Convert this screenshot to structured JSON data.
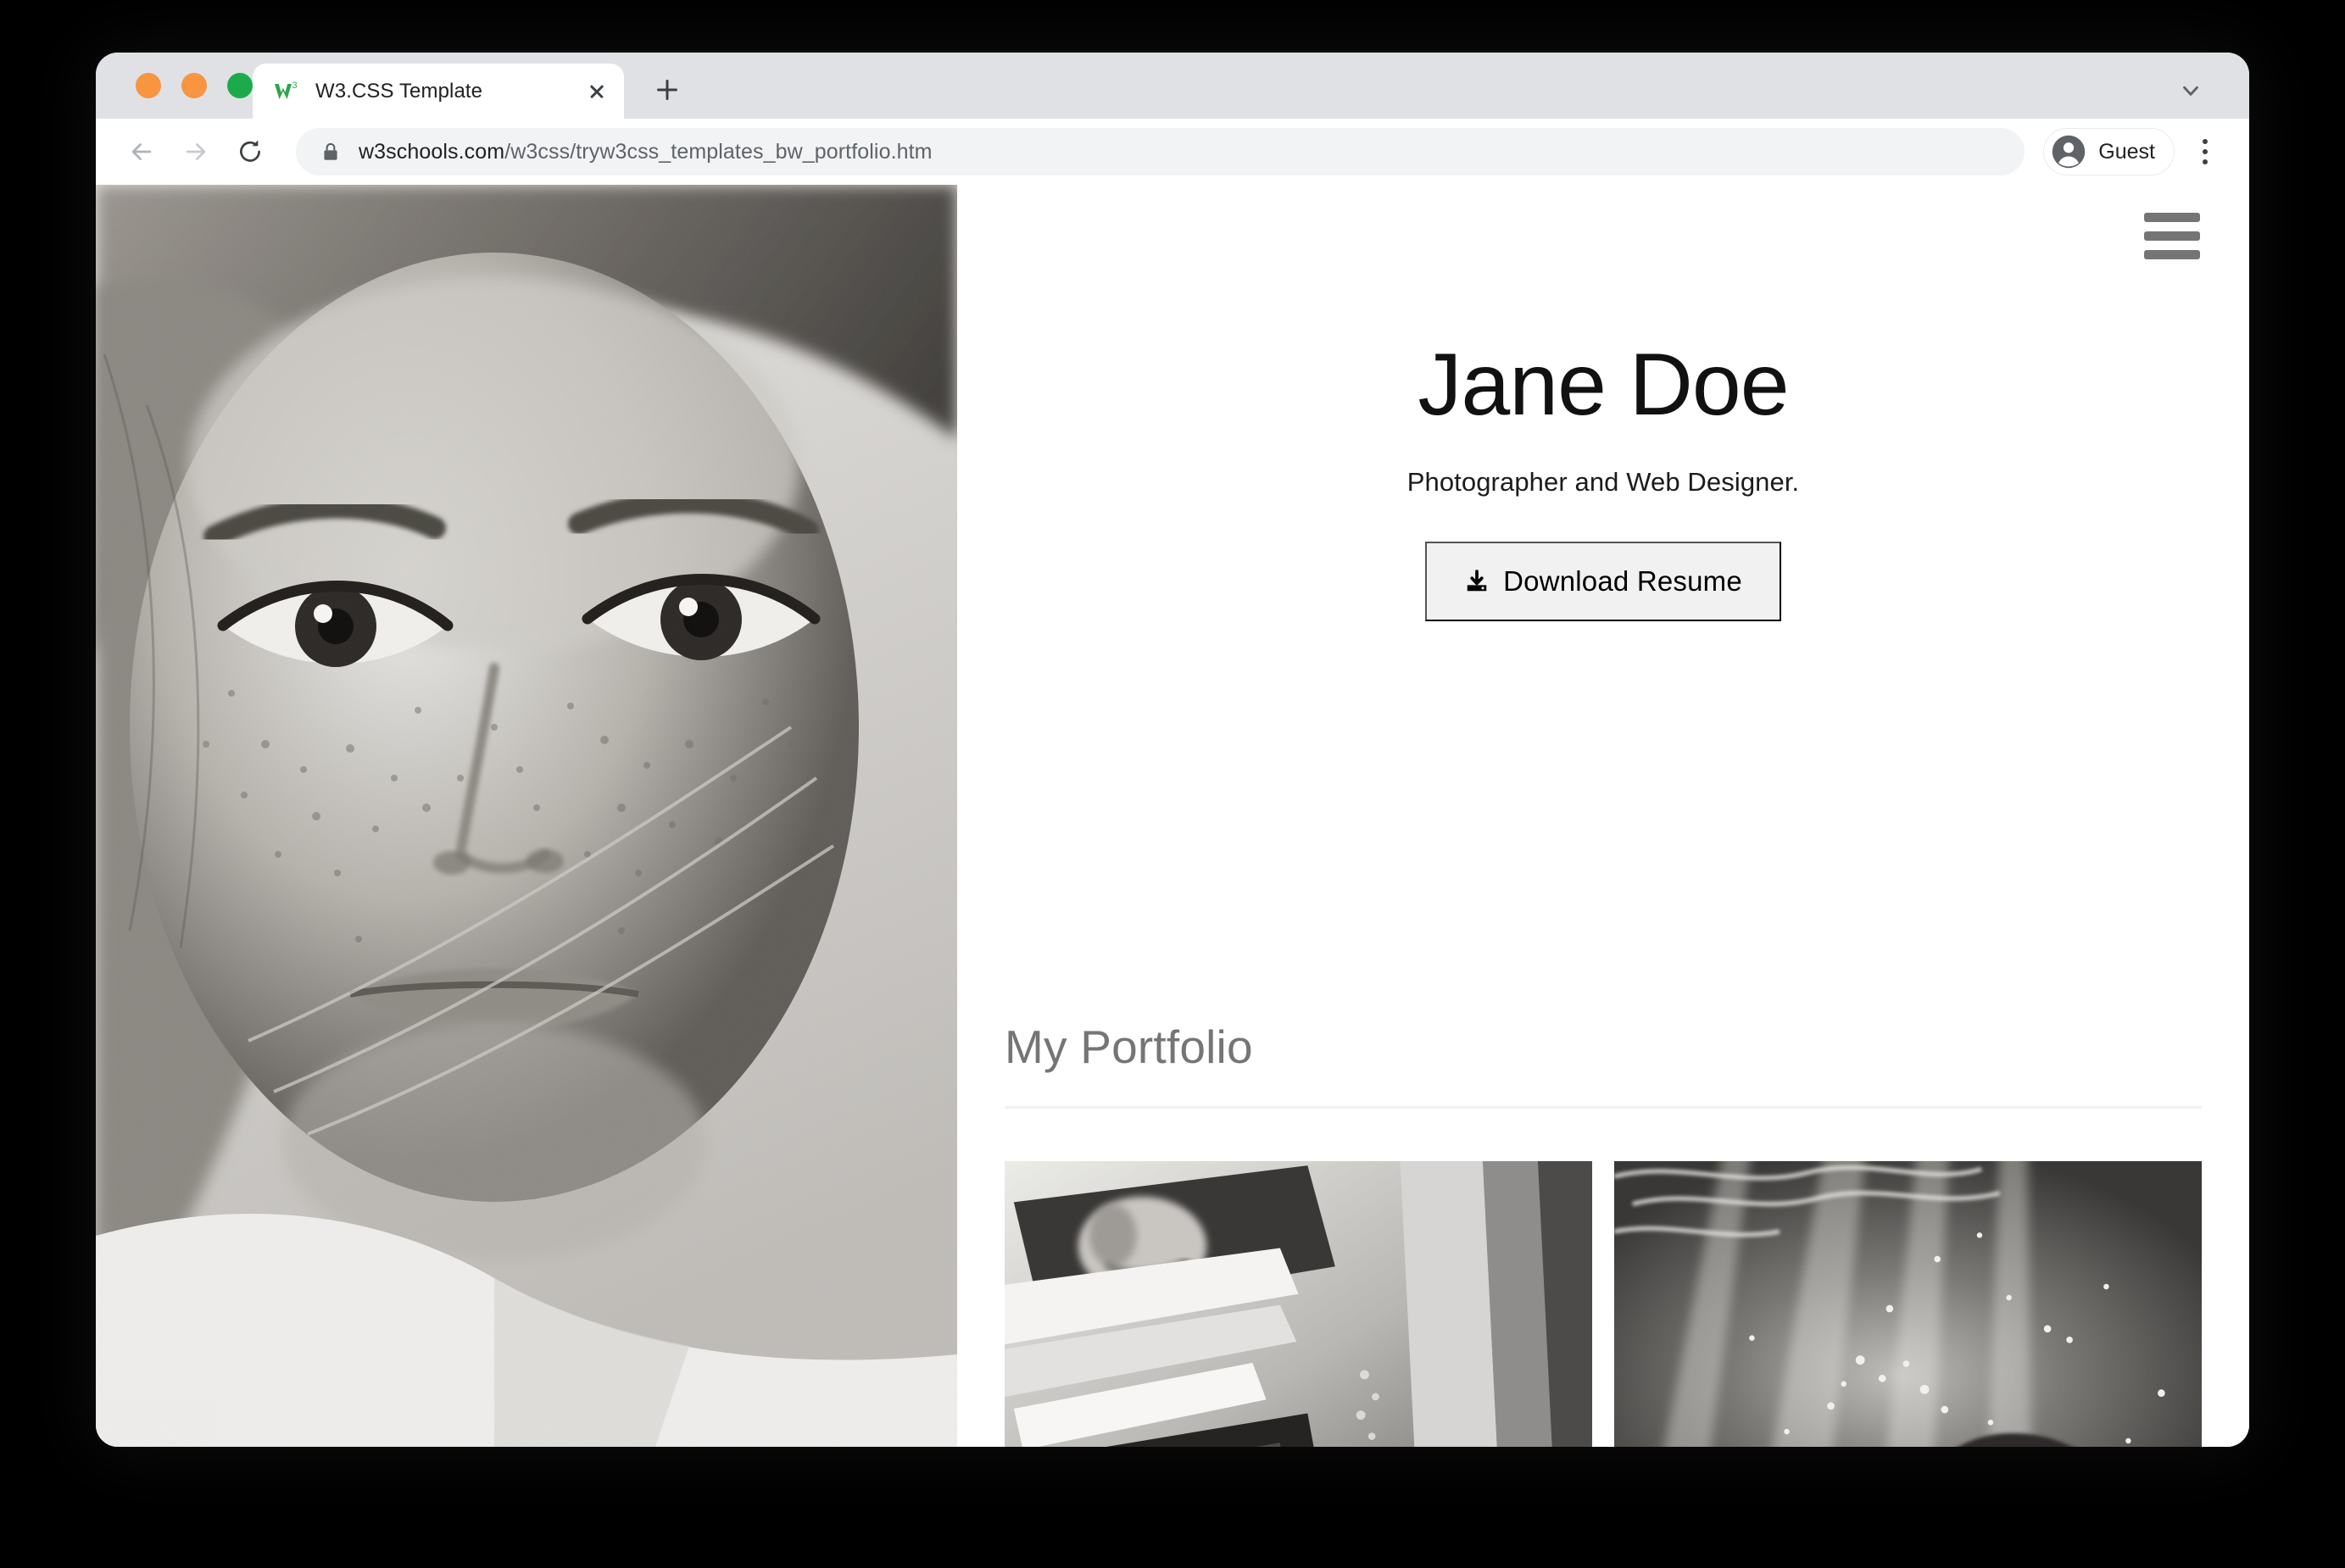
{
  "window": {
    "traffic_lights": [
      {
        "name": "close",
        "color": "#f79540"
      },
      {
        "name": "minimize",
        "color": "#f79540"
      },
      {
        "name": "maximize",
        "color": "#1cab4b"
      }
    ]
  },
  "browser": {
    "tab": {
      "title": "W3.CSS Template",
      "favicon_name": "w3schools-favicon",
      "favicon_color": "#2EA44F",
      "close_label": "×"
    },
    "new_tab_label": "+",
    "tab_search_icon": "chevron-down-icon",
    "toolbar": {
      "back_icon": "back-arrow-icon",
      "forward_icon": "forward-arrow-icon",
      "reload_icon": "reload-icon",
      "lock_icon": "lock-icon",
      "url_host": "w3schools.com",
      "url_path": "/w3css/tryw3css_templates_bw_portfolio.htm",
      "url_full": "w3schools.com/w3css/tryw3css_templates_bw_portfolio.htm",
      "profile_label": "Guest",
      "profile_icon": "account-circle-icon",
      "menu_icon": "three-dot-menu-icon"
    }
  },
  "page": {
    "menu_icon": "hamburger-menu-icon",
    "hero": {
      "name": "Jane Doe",
      "subtitle": "Photographer and Web Designer.",
      "button_label": "Download Resume",
      "button_icon": "download-icon",
      "button_bg": "#f1f1f1"
    },
    "portfolio": {
      "heading": "My Portfolio",
      "items": [
        {
          "name": "portfolio-image-car-window",
          "alt": "Black and white photo of woman in car window"
        },
        {
          "name": "portfolio-image-underwater",
          "alt": "Black and white underwater photo"
        }
      ]
    },
    "hero_photo": {
      "name": "hero-portrait-photo",
      "alt": "Black and white close-up portrait of freckled woman"
    },
    "colors": {
      "heading_gray": "#757575",
      "divider": "#f1f1f1",
      "text_dark": "#111111"
    }
  }
}
